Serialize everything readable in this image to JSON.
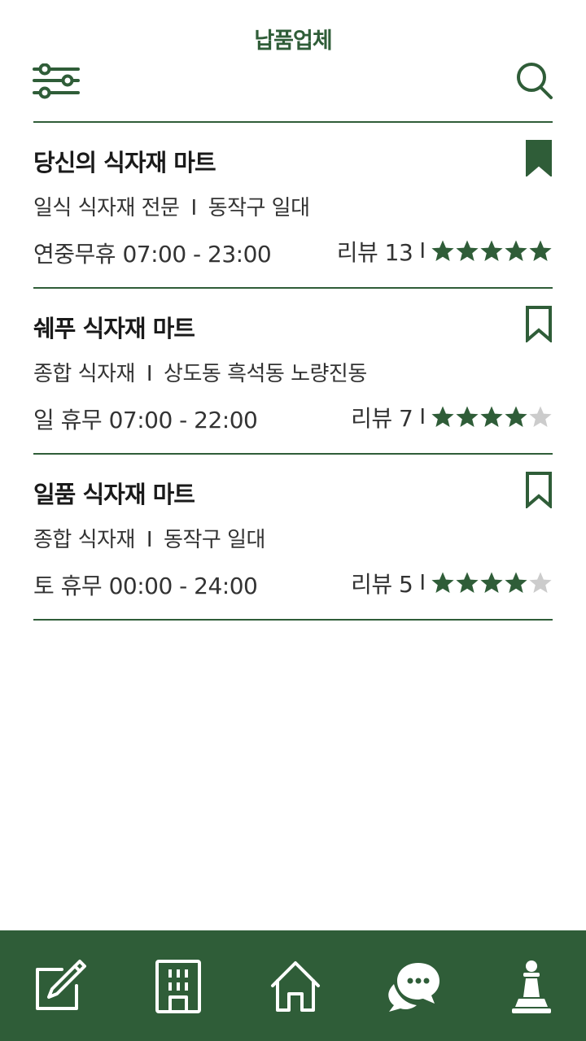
{
  "header": {
    "title": "납품업체",
    "filter_icon": "sliders-icon",
    "search_icon": "search-icon"
  },
  "colors": {
    "accent": "#2f5d38",
    "star_empty": "#cccccc",
    "text": "#333333"
  },
  "vendors": [
    {
      "name": "당신의 식자재 마트",
      "category": "일식 식자재 전문",
      "separator": "I",
      "area": "동작구 일대",
      "hours": "연중무휴 07:00 - 23:00",
      "review_label": "리뷰 13",
      "review_bar": "I",
      "rating": 5,
      "bookmarked": true
    },
    {
      "name": "쉐푸 식자재 마트",
      "category": "종합 식자재",
      "separator": "I",
      "area": "상도동 흑석동 노량진동",
      "hours": "일 휴무 07:00 - 22:00",
      "review_label": "리뷰 7",
      "review_bar": "I",
      "rating": 4,
      "bookmarked": false
    },
    {
      "name": "일품 식자재 마트",
      "category": "종합 식자재",
      "separator": "I",
      "area": "동작구 일대",
      "hours": "토 휴무 00:00 - 24:00",
      "review_label": "리뷰 5",
      "review_bar": "I",
      "rating": 4,
      "bookmarked": false
    }
  ],
  "bottom_nav": {
    "items": [
      "edit-icon",
      "building-icon",
      "home-icon",
      "chat-icon",
      "chess-pawn-icon"
    ]
  }
}
